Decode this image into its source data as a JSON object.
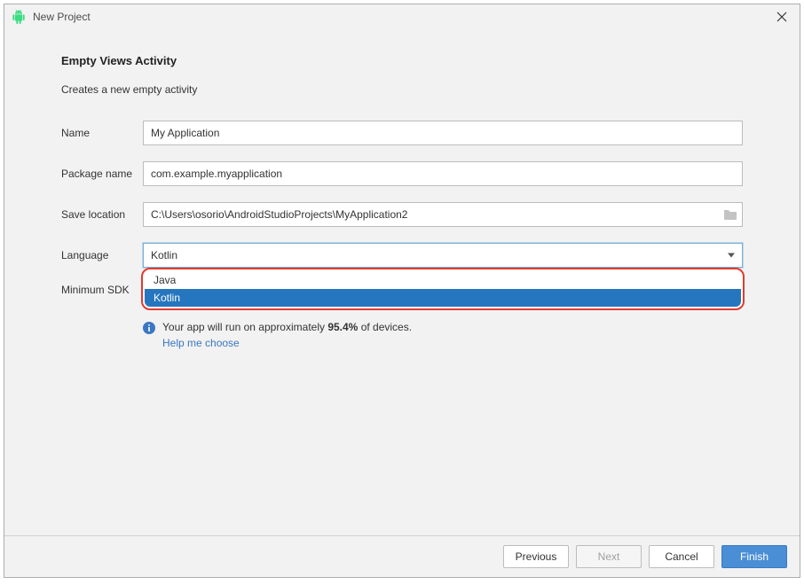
{
  "window": {
    "title": "New Project"
  },
  "section": {
    "title": "Empty Views Activity",
    "description": "Creates a new empty activity"
  },
  "form": {
    "name_label": "Name",
    "name_value": "My Application",
    "package_label": "Package name",
    "package_value": "com.example.myapplication",
    "location_label": "Save location",
    "location_value": "C:\\Users\\osorio\\AndroidStudioProjects\\MyApplication2",
    "language_label": "Language",
    "language_value": "Kotlin",
    "language_options": [
      "Java",
      "Kotlin"
    ],
    "language_selected_index": 1,
    "min_sdk_label": "Minimum SDK"
  },
  "info": {
    "text_prefix": "Your app will run on approximately ",
    "percent": "95.4%",
    "text_suffix": " of devices.",
    "link": "Help me choose"
  },
  "buttons": {
    "previous": "Previous",
    "next": "Next",
    "cancel": "Cancel",
    "finish": "Finish"
  }
}
